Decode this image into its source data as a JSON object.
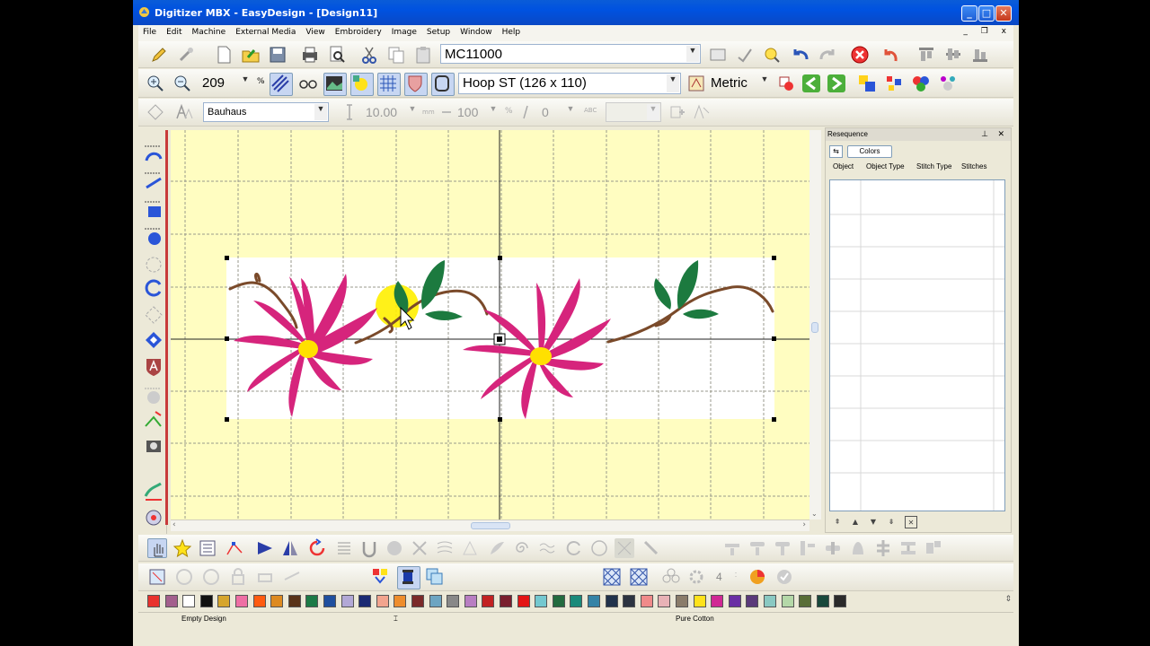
{
  "window": {
    "title": "Digitizer MBX - EasyDesign - [Design11]",
    "controls": [
      "_",
      "□",
      "✕"
    ]
  },
  "menu": {
    "items": [
      "File",
      "Edit",
      "Machine",
      "External Media",
      "View",
      "Embroidery",
      "Image",
      "Setup",
      "Window",
      "Help"
    ],
    "doc_controls": "_ ❐ x"
  },
  "toolbar1": {
    "machine_value": "MC11000"
  },
  "toolbar2": {
    "zoom_value": "209",
    "zoom_unit": "%",
    "hoop_value": "Hoop ST (126 x 110)",
    "units_value": "Metric"
  },
  "toolbar3": {
    "font_value": "Bauhaus",
    "height_value": "10.00",
    "height_unit": "mm",
    "width_value": "100",
    "width_unit": "%",
    "angle_value": "0",
    "abc_label": "ABC"
  },
  "panel": {
    "title": "Resequence",
    "colors_button": "Colors",
    "columns": [
      "Object",
      "Object Type",
      "Stitch Type",
      "Stitches"
    ]
  },
  "bottom_toolbar": {
    "count_value": "4"
  },
  "palette": {
    "colors": [
      "#e8322e",
      "#a35f8d",
      "#ffffff",
      "#111111",
      "#d6a52c",
      "#ee6fa4",
      "#ff5b10",
      "#dd8a20",
      "#593318",
      "#1c7a46",
      "#1f4f9e",
      "#b2a8d6",
      "#1b2a73",
      "#f2a48e",
      "#ee8d2c",
      "#7b2a2a",
      "#6da5c2",
      "#888888",
      "#b87ec2",
      "#c22222",
      "#7a1f2e",
      "#e31515",
      "#74c8cf",
      "#236b3f",
      "#1a8a7a",
      "#3583a6",
      "#21324b",
      "#2c3340",
      "#f08a8a",
      "#e8b2b6",
      "#8a7c6a",
      "#ffe21a",
      "#d02894",
      "#6a2fa4",
      "#5b3a7a",
      "#8ac9c2",
      "#b4d8a8",
      "#596e37",
      "#18483b",
      "#2a2a2a"
    ]
  },
  "status": {
    "left": "Empty Design",
    "right": "Pure Cotton"
  }
}
